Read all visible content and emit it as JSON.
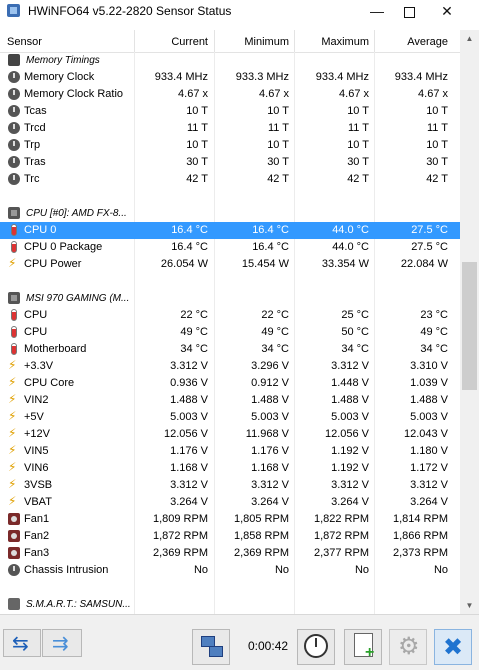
{
  "window": {
    "title": "HWiNFO64 v5.22-2820 Sensor Status",
    "minimize_icon": "minimize-icon",
    "maximize_icon": "maximize-icon",
    "close_icon": "close-icon"
  },
  "columns": [
    "Sensor",
    "Current",
    "Minimum",
    "Maximum",
    "Average"
  ],
  "rows": [
    {
      "type": "group",
      "icon": "memory-icon",
      "label": "Memory Timings"
    },
    {
      "type": "item",
      "icon": "clock-icon",
      "label": "Memory Clock",
      "current": "933.4 MHz",
      "min": "933.3 MHz",
      "max": "933.4 MHz",
      "avg": "933.4 MHz"
    },
    {
      "type": "item",
      "icon": "clock-icon",
      "label": "Memory Clock Ratio",
      "current": "4.67 x",
      "min": "4.67 x",
      "max": "4.67 x",
      "avg": "4.67 x"
    },
    {
      "type": "item",
      "icon": "clock-icon",
      "label": "Tcas",
      "current": "10 T",
      "min": "10 T",
      "max": "10 T",
      "avg": "10 T"
    },
    {
      "type": "item",
      "icon": "clock-icon",
      "label": "Trcd",
      "current": "11 T",
      "min": "11 T",
      "max": "11 T",
      "avg": "11 T"
    },
    {
      "type": "item",
      "icon": "clock-icon",
      "label": "Trp",
      "current": "10 T",
      "min": "10 T",
      "max": "10 T",
      "avg": "10 T"
    },
    {
      "type": "item",
      "icon": "clock-icon",
      "label": "Tras",
      "current": "30 T",
      "min": "30 T",
      "max": "30 T",
      "avg": "30 T"
    },
    {
      "type": "item",
      "icon": "clock-icon",
      "label": "Trc",
      "current": "42 T",
      "min": "42 T",
      "max": "42 T",
      "avg": "42 T"
    },
    {
      "type": "blank"
    },
    {
      "type": "group",
      "icon": "chip-icon",
      "label": "CPU [#0]: AMD FX-8..."
    },
    {
      "type": "item",
      "icon": "thermometer-icon",
      "label": "CPU 0",
      "current": "16.4 °C",
      "min": "16.4 °C",
      "max": "44.0 °C",
      "avg": "27.5 °C",
      "selected": true
    },
    {
      "type": "item",
      "icon": "thermometer-icon",
      "label": "CPU 0 Package",
      "current": "16.4 °C",
      "min": "16.4 °C",
      "max": "44.0 °C",
      "avg": "27.5 °C"
    },
    {
      "type": "item",
      "icon": "lightning-icon",
      "label": "CPU Power",
      "current": "26.054 W",
      "min": "15.454 W",
      "max": "33.354 W",
      "avg": "22.084 W"
    },
    {
      "type": "blank"
    },
    {
      "type": "group",
      "icon": "chip-icon",
      "label": "MSI 970 GAMING (M..."
    },
    {
      "type": "item",
      "icon": "thermometer-icon",
      "label": "CPU",
      "current": "22 °C",
      "min": "22 °C",
      "max": "25 °C",
      "avg": "23 °C"
    },
    {
      "type": "item",
      "icon": "thermometer-icon",
      "label": "CPU",
      "current": "49 °C",
      "min": "49 °C",
      "max": "50 °C",
      "avg": "49 °C"
    },
    {
      "type": "item",
      "icon": "thermometer-icon",
      "label": "Motherboard",
      "current": "34 °C",
      "min": "34 °C",
      "max": "34 °C",
      "avg": "34 °C"
    },
    {
      "type": "item",
      "icon": "lightning-icon",
      "label": "+3.3V",
      "current": "3.312 V",
      "min": "3.296 V",
      "max": "3.312 V",
      "avg": "3.310 V"
    },
    {
      "type": "item",
      "icon": "lightning-icon",
      "label": "CPU Core",
      "current": "0.936 V",
      "min": "0.912 V",
      "max": "1.448 V",
      "avg": "1.039 V"
    },
    {
      "type": "item",
      "icon": "lightning-icon",
      "label": "VIN2",
      "current": "1.488 V",
      "min": "1.488 V",
      "max": "1.488 V",
      "avg": "1.488 V"
    },
    {
      "type": "item",
      "icon": "lightning-icon",
      "label": "+5V",
      "current": "5.003 V",
      "min": "5.003 V",
      "max": "5.003 V",
      "avg": "5.003 V"
    },
    {
      "type": "item",
      "icon": "lightning-icon",
      "label": "+12V",
      "current": "12.056 V",
      "min": "11.968 V",
      "max": "12.056 V",
      "avg": "12.043 V"
    },
    {
      "type": "item",
      "icon": "lightning-icon",
      "label": "VIN5",
      "current": "1.176 V",
      "min": "1.176 V",
      "max": "1.192 V",
      "avg": "1.180 V"
    },
    {
      "type": "item",
      "icon": "lightning-icon",
      "label": "VIN6",
      "current": "1.168 V",
      "min": "1.168 V",
      "max": "1.192 V",
      "avg": "1.172 V"
    },
    {
      "type": "item",
      "icon": "lightning-icon",
      "label": "3VSB",
      "current": "3.312 V",
      "min": "3.312 V",
      "max": "3.312 V",
      "avg": "3.312 V"
    },
    {
      "type": "item",
      "icon": "lightning-icon",
      "label": "VBAT",
      "current": "3.264 V",
      "min": "3.264 V",
      "max": "3.264 V",
      "avg": "3.264 V"
    },
    {
      "type": "item",
      "icon": "fan-icon",
      "label": "Fan1",
      "current": "1,809 RPM",
      "min": "1,805 RPM",
      "max": "1,822 RPM",
      "avg": "1,814 RPM"
    },
    {
      "type": "item",
      "icon": "fan-icon",
      "label": "Fan2",
      "current": "1,872 RPM",
      "min": "1,858 RPM",
      "max": "1,872 RPM",
      "avg": "1,866 RPM"
    },
    {
      "type": "item",
      "icon": "fan-icon",
      "label": "Fan3",
      "current": "2,369 RPM",
      "min": "2,369 RPM",
      "max": "2,377 RPM",
      "avg": "2,373 RPM"
    },
    {
      "type": "item",
      "icon": "clock-icon",
      "label": "Chassis Intrusion",
      "current": "No",
      "min": "No",
      "max": "No",
      "avg": "No"
    },
    {
      "type": "blank"
    },
    {
      "type": "group",
      "icon": "drive-icon",
      "label": "S.M.A.R.T.: SAMSUN..."
    }
  ],
  "toolbar": {
    "elapsed_time": "0:00:42",
    "nav_left_icon": "arrows-left-right-icon",
    "nav_right_icon": "arrows-collapse-icon",
    "network_icon": "network-icon",
    "clock_icon": "clock-icon",
    "report_icon": "add-report-icon",
    "settings_icon": "gear-icon",
    "close_icon": "close-icon"
  }
}
